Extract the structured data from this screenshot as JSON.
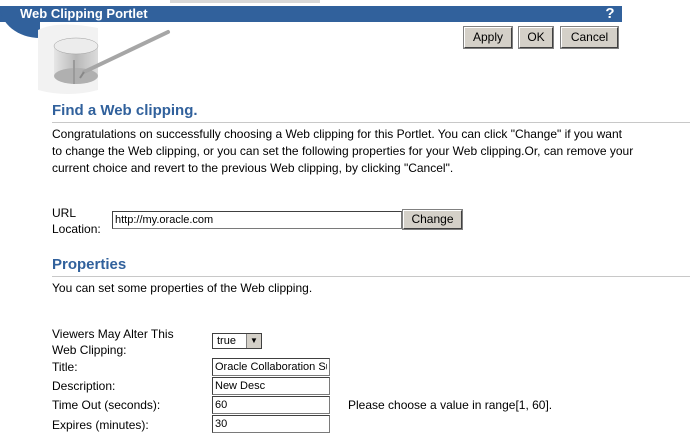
{
  "header": {
    "title": "Web Clipping Portlet",
    "help_label": "?"
  },
  "toolbar": {
    "apply_label": "Apply",
    "ok_label": "OK",
    "cancel_label": "Cancel"
  },
  "find": {
    "title": "Find a Web clipping.",
    "lines": [
      "Congratulations on successfully choosing a Web clipping for this Portlet. You can click \"Change\" if you want",
      "to change the Web clipping, or you can set the following properties for your Web clipping.Or, can remove your",
      "current choice and revert to the previous Web clipping, by clicking \"Cancel\"."
    ],
    "url_label_1": "URL",
    "url_label_2": "Location:",
    "url_value": "http://my.oracle.com",
    "change_label": "Change"
  },
  "properties": {
    "title": "Properties",
    "description": "You can set some properties of the Web clipping.",
    "viewers_label_1": "Viewers May Alter This",
    "viewers_label_2": "Web Clipping:",
    "viewers_value": "true",
    "title_label": "Title:",
    "title_value": "Oracle Collaboration Suite",
    "description_label": "Description:",
    "description_value": "New Desc",
    "timeout_label": "Time Out (seconds):",
    "timeout_value": "60",
    "timeout_hint": "Please choose a value in range[1, 60].",
    "expires_label": "Expires (minutes):",
    "expires_value": "30"
  }
}
